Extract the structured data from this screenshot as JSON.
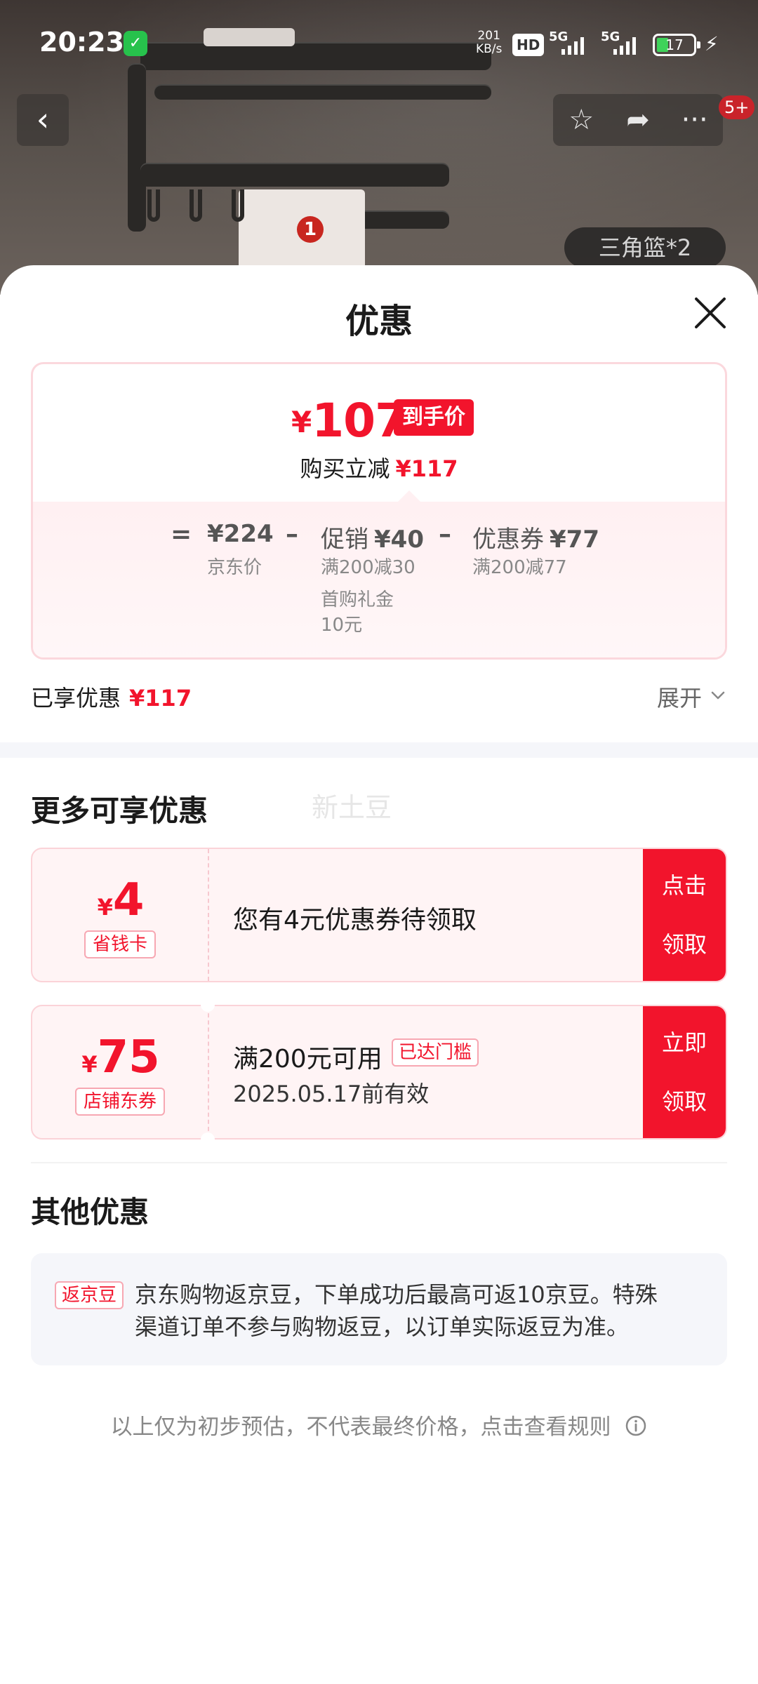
{
  "status_bar": {
    "time": "20:23",
    "speed_value": "201",
    "speed_unit": "KB/s",
    "hd_label": "HD",
    "net_1": "5G",
    "net_2": "5G",
    "battery": "17"
  },
  "hero": {
    "badge": "1",
    "tag": "三角篮*2",
    "messages_badge": "5+"
  },
  "sheet": {
    "title": "优惠"
  },
  "price_card": {
    "currency": "¥",
    "final_price": "107",
    "final_label": "到手价",
    "instant_label": "购买立减",
    "instant_value": "¥117",
    "equals": "=",
    "minus": "–",
    "base_price": "¥224",
    "base_label": "京东价",
    "promo_label": "促销",
    "promo_value": "¥40",
    "promo_rule_1": "满200减30",
    "promo_rule_2a": "首购礼金",
    "promo_rule_2b": "10元",
    "coupon_label": "优惠券",
    "coupon_value": "¥77",
    "coupon_rule": "满200减77"
  },
  "enjoyed": {
    "label": "已享优惠",
    "value": "¥117",
    "expand": "展开"
  },
  "more": {
    "title": "更多可享优惠",
    "watermark": "新土豆",
    "coupons": [
      {
        "currency": "¥",
        "amount": "4",
        "kind": "省钱卡",
        "desc": "您有4元优惠券待领取",
        "cta_1": "点击",
        "cta_2": "领取"
      },
      {
        "currency": "¥",
        "amount": "75",
        "kind": "店铺东券",
        "desc": "满200元可用",
        "reach": "已达门槛",
        "valid": "2025.05.17前有效",
        "cta_1": "立即",
        "cta_2": "领取"
      }
    ]
  },
  "other": {
    "title": "其他优惠",
    "tag": "返京豆",
    "line_1": "京东购物返京豆，下单成功后最高可返10京豆。特殊",
    "line_2": "渠道订单不参与购物返豆，以订单实际返豆为准。"
  },
  "footnote": "以上仅为初步预估，不代表最终价格，点击查看规则",
  "colors": {
    "brand_red": "#f2142c",
    "coupon_bg": "#fff4f5",
    "panel_bg": "#f5f6fa"
  },
  "icons": [
    "back-icon",
    "star-icon",
    "share-icon",
    "more-icon",
    "close-icon",
    "chevron-down-icon",
    "info-icon",
    "shield-icon",
    "charging-icon"
  ]
}
